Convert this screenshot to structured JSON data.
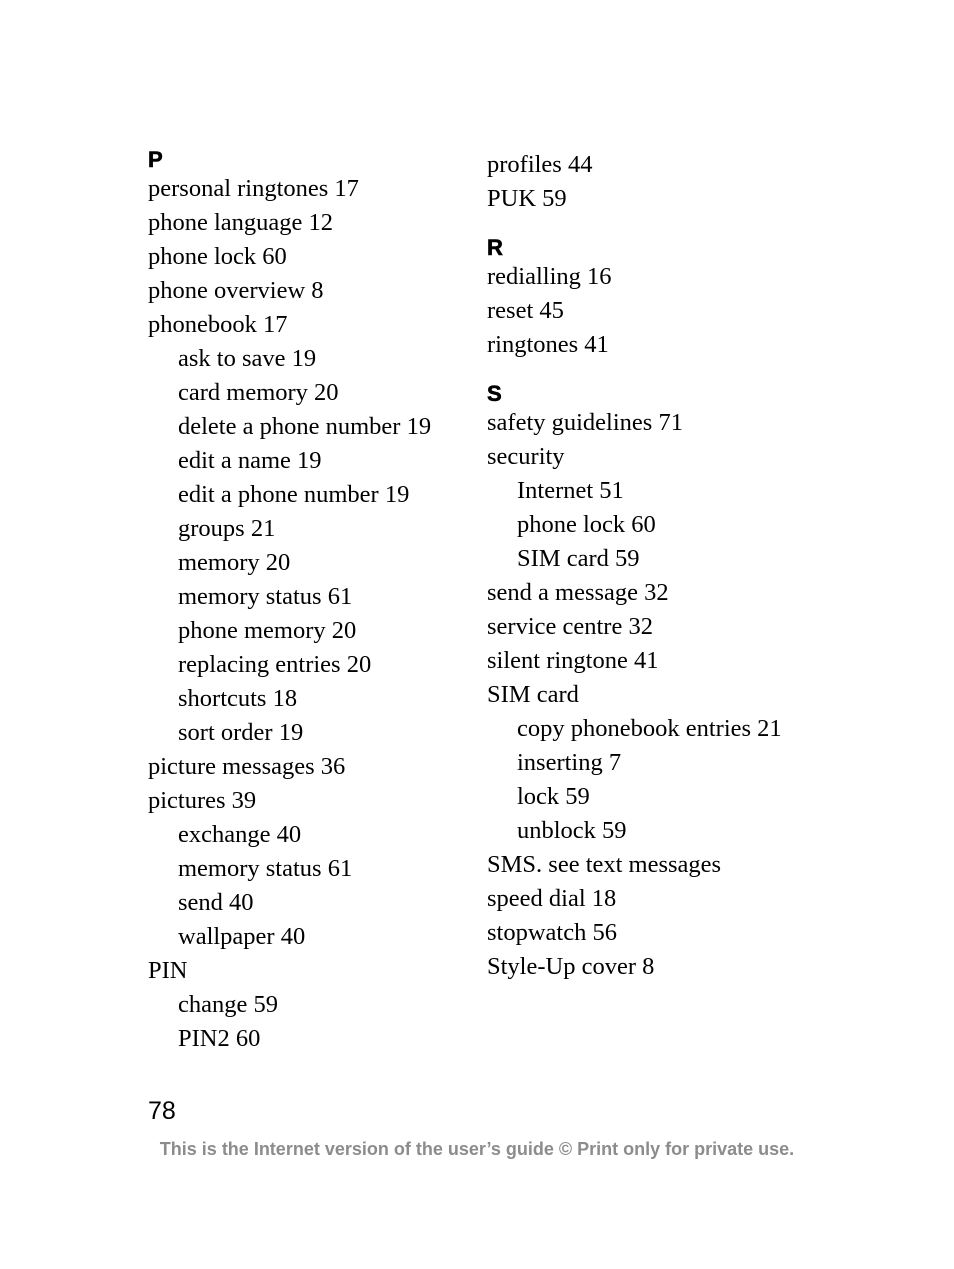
{
  "index": {
    "left_column": [
      {
        "type": "heading",
        "text": "P"
      },
      {
        "type": "entry",
        "text": "personal ringtones 17"
      },
      {
        "type": "entry",
        "text": "phone language 12"
      },
      {
        "type": "entry",
        "text": "phone lock 60"
      },
      {
        "type": "entry",
        "text": "phone overview 8"
      },
      {
        "type": "entry",
        "text": "phonebook 17"
      },
      {
        "type": "sub",
        "text": "ask to save 19"
      },
      {
        "type": "sub",
        "text": "card memory 20"
      },
      {
        "type": "sub",
        "text": "delete a phone number 19"
      },
      {
        "type": "sub",
        "text": "edit a name 19"
      },
      {
        "type": "sub",
        "text": "edit a phone number 19"
      },
      {
        "type": "sub",
        "text": "groups 21"
      },
      {
        "type": "sub",
        "text": "memory 20"
      },
      {
        "type": "sub",
        "text": "memory status 61"
      },
      {
        "type": "sub",
        "text": "phone memory 20"
      },
      {
        "type": "sub",
        "text": "replacing entries 20"
      },
      {
        "type": "sub",
        "text": "shortcuts 18"
      },
      {
        "type": "sub",
        "text": "sort order 19"
      },
      {
        "type": "entry",
        "text": "picture messages 36"
      },
      {
        "type": "entry",
        "text": "pictures 39"
      },
      {
        "type": "sub",
        "text": "exchange 40"
      },
      {
        "type": "sub",
        "text": "memory status 61"
      },
      {
        "type": "sub",
        "text": "send 40"
      },
      {
        "type": "sub",
        "text": "wallpaper 40"
      },
      {
        "type": "entry",
        "text": "PIN"
      },
      {
        "type": "sub",
        "text": "change 59"
      },
      {
        "type": "sub",
        "text": "PIN2 60"
      }
    ],
    "right_column": [
      {
        "type": "entry",
        "text": "profiles 44"
      },
      {
        "type": "entry",
        "text": "PUK 59"
      },
      {
        "type": "spacer"
      },
      {
        "type": "heading",
        "text": "R"
      },
      {
        "type": "entry",
        "text": "redialling 16"
      },
      {
        "type": "entry",
        "text": "reset 45"
      },
      {
        "type": "entry",
        "text": "ringtones 41"
      },
      {
        "type": "spacer"
      },
      {
        "type": "heading",
        "text": "S"
      },
      {
        "type": "entry",
        "text": "safety guidelines 71"
      },
      {
        "type": "entry",
        "text": "security"
      },
      {
        "type": "sub",
        "text": "Internet 51"
      },
      {
        "type": "sub",
        "text": "phone lock 60"
      },
      {
        "type": "sub",
        "text": "SIM card 59"
      },
      {
        "type": "entry",
        "text": "send a message 32"
      },
      {
        "type": "entry",
        "text": "service centre 32"
      },
      {
        "type": "entry",
        "text": "silent ringtone 41"
      },
      {
        "type": "entry",
        "text": "SIM card"
      },
      {
        "type": "sub",
        "text": "copy phonebook entries 21"
      },
      {
        "type": "sub",
        "text": "inserting 7"
      },
      {
        "type": "sub",
        "text": "lock 59"
      },
      {
        "type": "sub",
        "text": "unblock 59"
      },
      {
        "type": "entry",
        "text": "SMS. see text messages"
      },
      {
        "type": "entry",
        "text": "speed dial 18"
      },
      {
        "type": "entry",
        "text": "stopwatch 56"
      },
      {
        "type": "entry",
        "text": "Style-Up cover 8"
      }
    ]
  },
  "page_number": "78",
  "footer_note": "This is the Internet version of the user’s guide © Print only for private use.",
  "colors": {
    "text": "#000000",
    "footer": "#8c8c8c"
  }
}
